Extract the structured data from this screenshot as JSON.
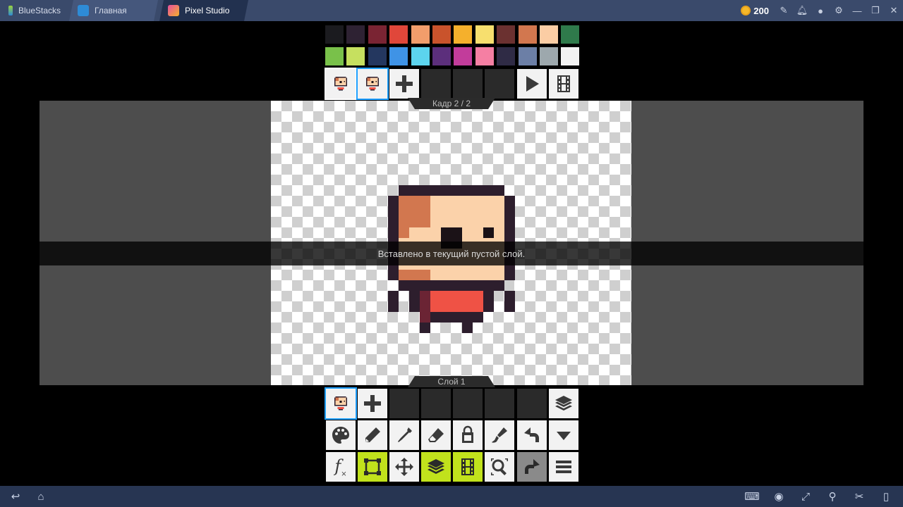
{
  "window": {
    "brand": "BlueStacks",
    "tabs": [
      {
        "label": "Главная"
      },
      {
        "label": "Pixel Studio"
      }
    ],
    "coins": "200"
  },
  "palette": {
    "row1": [
      "#1b1b1f",
      "#2e2233",
      "#7a2433",
      "#e0473a",
      "#f29d6b",
      "#c9532c",
      "#f5b02c",
      "#f7df6e",
      "#6b3130",
      "#d2774f",
      "#fbcda4",
      "#2f7a4b"
    ],
    "row2": [
      "#79c14a",
      "#c6e05f",
      "#24375f",
      "#3f93e6",
      "#5cd4ee",
      "#5c2f7c",
      "#c23c9b",
      "#f57fa3",
      "#2f2b45",
      "#6c7fa6",
      "#9da8ad",
      "#f2f2f2"
    ]
  },
  "frames": {
    "label": "Кадр 2 / 2",
    "items": [
      {
        "state": "current"
      },
      {
        "state": "selected"
      }
    ],
    "add_label": "+",
    "play_icon": "play-icon",
    "film_icon": "film-icon"
  },
  "layers": {
    "label": "Слой 1"
  },
  "toast": "Вставлено в текущий пустой слой.",
  "tools": {
    "row1": [
      "palette-icon",
      "pencil-icon",
      "eyedropper-icon",
      "eraser-icon",
      "bucket-icon",
      "brush-icon",
      "undo-icon",
      "dropdown-icon"
    ],
    "row2": [
      "fx-icon",
      "selection-icon",
      "move-icon",
      "layers-icon",
      "film-icon",
      "zoom-icon",
      "redo-icon",
      "menu-icon"
    ],
    "fx_label": "f"
  }
}
